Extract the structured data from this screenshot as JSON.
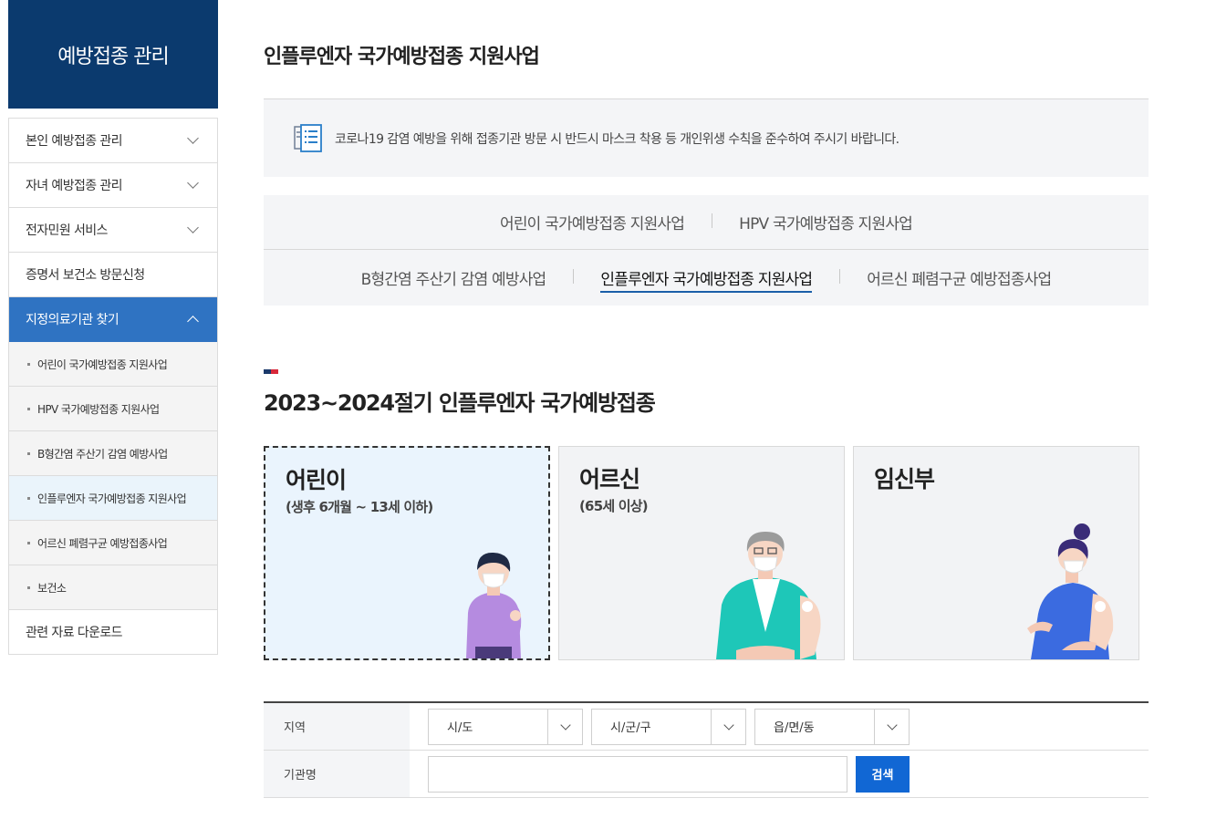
{
  "sidebar": {
    "title": "예방접종 관리",
    "items": [
      {
        "label": "본인 예방접종 관리"
      },
      {
        "label": "자녀 예방접종 관리"
      },
      {
        "label": "전자민원 서비스"
      },
      {
        "label": "증명서 보건소 방문신청"
      },
      {
        "label": "지정의료기관 찾기"
      }
    ],
    "sub_items": [
      {
        "label": "어린이 국가예방접종 지원사업"
      },
      {
        "label": "HPV 국가예방접종 지원사업"
      },
      {
        "label": "B형간염 주산기 감염 예방사업"
      },
      {
        "label": "인플루엔자 국가예방접종 지원사업"
      },
      {
        "label": "어르신 폐렴구균 예방접종사업"
      },
      {
        "label": "보건소"
      }
    ],
    "last_item": {
      "label": "관련 자료 다운로드"
    }
  },
  "page": {
    "title": "인플루엔자 국가예방접종 지원사업",
    "notice": "코로나19 감염 예방을 위해 접종기관 방문 시 반드시 마스크 착용 등 개인위생 수칙을 준수하여 주시기 바랍니다."
  },
  "tabs": {
    "row1": [
      "어린이 국가예방접종 지원사업",
      "HPV 국가예방접종 지원사업"
    ],
    "row2": [
      "B형간염 주산기 감염 예방사업",
      "인플루엔자 국가예방접종 지원사업",
      "어르신 폐렴구균 예방접종사업"
    ]
  },
  "section": {
    "title": "2023~2024절기 인플루엔자 국가예방접종"
  },
  "cards": [
    {
      "title": "어린이",
      "sub": "(생후 6개월 ~ 13세 이하)"
    },
    {
      "title": "어르신",
      "sub": "(65세 이상)"
    },
    {
      "title": "임신부",
      "sub": ""
    }
  ],
  "form": {
    "region_label": "지역",
    "sido": "시/도",
    "sigungu": "시/군/구",
    "dong": "읍/면/동",
    "name_label": "기관명",
    "name_value": "",
    "search_label": "검색"
  },
  "colors": {
    "brand_navy": "#0b3a6e",
    "sidebar_active": "#2f73c2",
    "button_blue": "#1167d4",
    "mark_navy": "#1b3a6b",
    "mark_red": "#d8283a"
  }
}
